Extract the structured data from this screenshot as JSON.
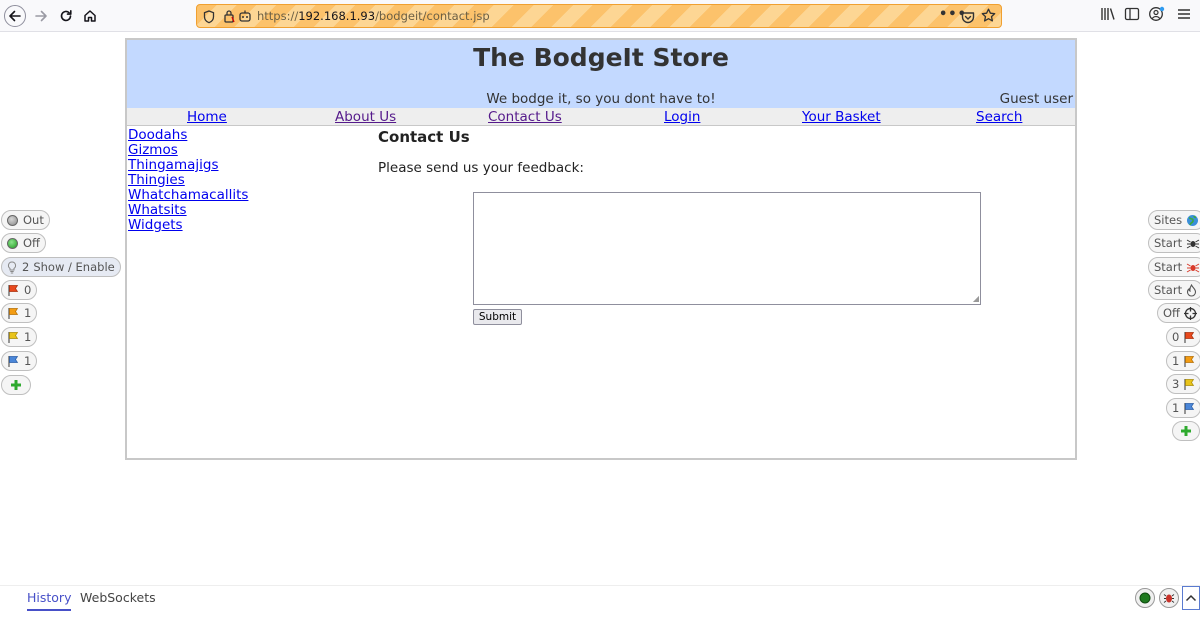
{
  "browser": {
    "url_prefix": "https://",
    "url_host": "192.168.1.93",
    "url_path": "/bodgeit/contact.jsp",
    "more_label": "•••"
  },
  "page": {
    "title": "The BodgeIt Store",
    "tagline": "We bodge it, so you dont have to!",
    "user_label": "Guest user",
    "menu": {
      "home": "Home",
      "about": "About Us",
      "contact": "Contact Us",
      "login": "Login",
      "basket": "Your Basket",
      "search": "Search"
    },
    "categories": [
      "Doodahs",
      "Gizmos",
      "Thingamajigs",
      "Thingies",
      "Whatchamacallits",
      "Whatsits",
      "Widgets"
    ],
    "heading": "Contact Us",
    "prompt": "Please send us your feedback:",
    "submit_label": "Submit"
  },
  "hud_left": {
    "scope_label": "Out",
    "break_label": "Off",
    "hidden_count": "2",
    "hidden_label": "Show / Enable",
    "alerts_high": "0",
    "alerts_medium": "1",
    "alerts_low": "1",
    "alerts_info": "1"
  },
  "hud_right": {
    "sites_label": "Sites",
    "spider_label": "Start",
    "ajax_spider_label": "Start",
    "active_scan_label": "Start",
    "attack_mode_label": "Off",
    "alerts_high": "0",
    "alerts_medium": "1",
    "alerts_low": "3",
    "alerts_info": "1"
  },
  "hud_bottom": {
    "tab_history": "History",
    "tab_websockets": "WebSockets"
  },
  "colors": {
    "header_bg": "#c3d9ff",
    "flag_red": "#e8481c",
    "flag_orange": "#f39c12",
    "flag_yellow": "#e9c41a",
    "flag_blue": "#4a86d8",
    "plus_green": "#2eaa2e"
  }
}
